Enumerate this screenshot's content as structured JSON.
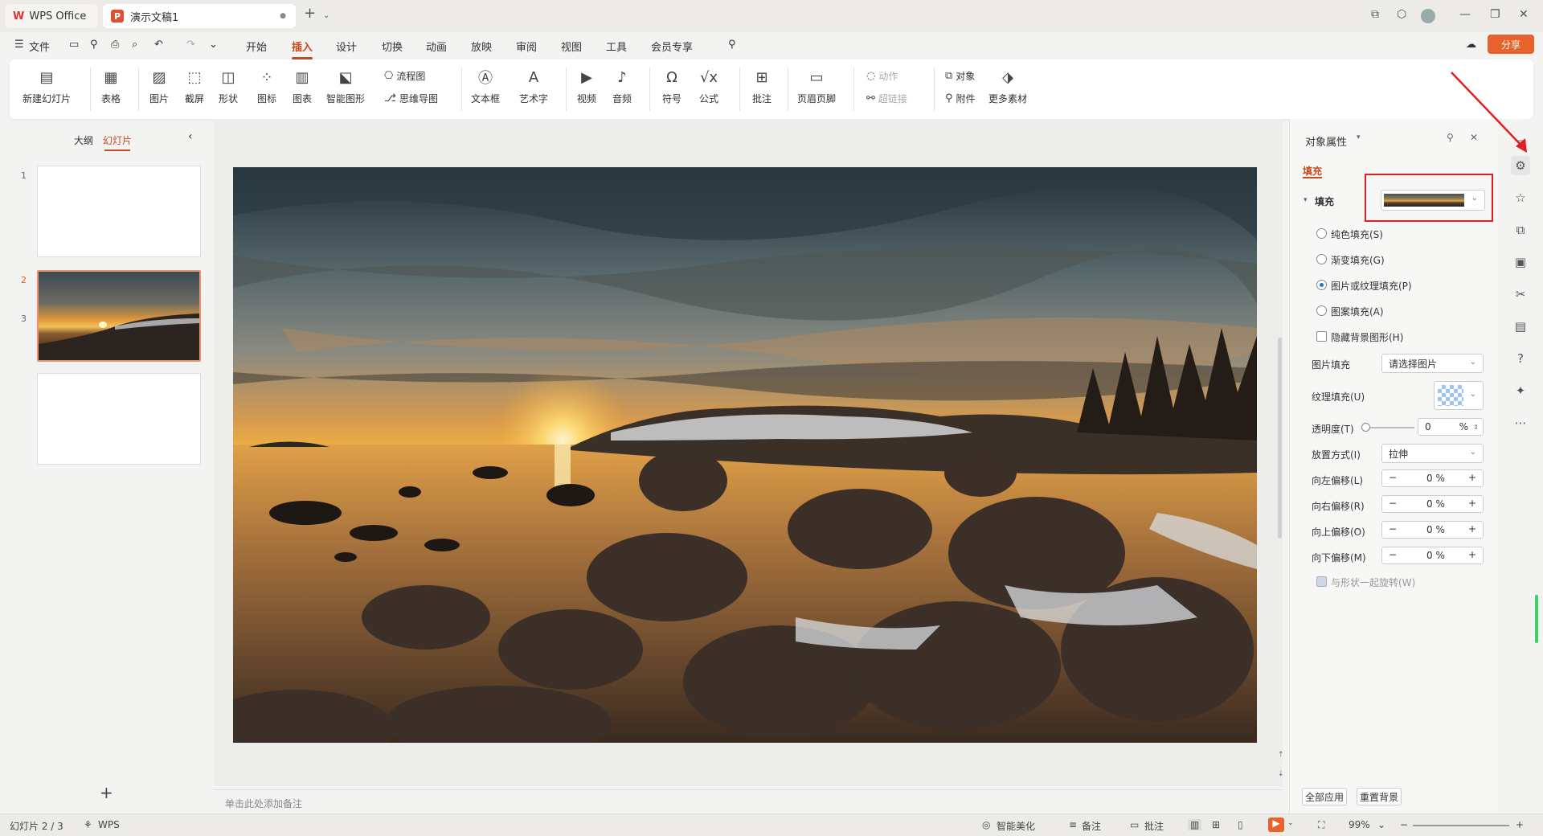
{
  "titlebar": {
    "app_tab": "WPS Office",
    "doc_tab": "演示文稿1",
    "new_tab_icon": "plus-icon"
  },
  "menubar": {
    "file": "文件",
    "items": [
      "开始",
      "插入",
      "设计",
      "切换",
      "动画",
      "放映",
      "审阅",
      "视图",
      "工具",
      "会员专享"
    ],
    "active": "插入",
    "share": "分享"
  },
  "ribbon": {
    "new_slide": "新建幻灯片",
    "table": "表格",
    "picture": "图片",
    "screenshot": "截屏",
    "shape": "形状",
    "icon": "图标",
    "chart": "图表",
    "smart_art": "智能图形",
    "flowchart": "流程图",
    "mindmap": "思维导图",
    "textbox": "文本框",
    "wordart": "艺术字",
    "video": "视频",
    "audio": "音频",
    "symbol": "符号",
    "formula": "公式",
    "comment": "批注",
    "header_footer": "页眉页脚",
    "action": "动作",
    "hyperlink": "超链接",
    "object": "对象",
    "attachment": "附件",
    "more_material": "更多素材"
  },
  "left_panel": {
    "tab_outline": "大纲",
    "tab_slides": "幻灯片",
    "slides": [
      "1",
      "2",
      "3"
    ],
    "selected": "2"
  },
  "notes_placeholder": "单击此处添加备注",
  "props": {
    "title": "对象属性",
    "tab_fill": "填充",
    "section_fill": "填充",
    "solid": "纯色填充(S)",
    "gradient": "渐变填充(G)",
    "picture_texture": "图片或纹理填充(P)",
    "pattern": "图案填充(A)",
    "hide_bg": "隐藏背景图形(H)",
    "picture_fill_label": "图片填充",
    "picture_fill_value": "请选择图片",
    "texture_label": "纹理填充(U)",
    "transparency_label": "透明度(T)",
    "transparency_value": "0",
    "percent": "%",
    "placement_label": "放置方式(I)",
    "placement_value": "拉伸",
    "offset_left_label": "向左偏移(L)",
    "offset_right_label": "向右偏移(R)",
    "offset_up_label": "向上偏移(O)",
    "offset_down_label": "向下偏移(M)",
    "offset_value": "0 %",
    "rotate_with_shape": "与形状一起旋转(W)",
    "apply_all": "全部应用",
    "reset_bg": "重置背景"
  },
  "statusbar": {
    "slide_info": "幻灯片 2 / 3",
    "wps": "WPS",
    "beautify": "智能美化",
    "notes": "备注",
    "comments": "批注",
    "zoom": "99%"
  },
  "colors": {
    "accent": "#c7491f",
    "highlight_box": "#e02020",
    "arrow": "#e02020"
  }
}
